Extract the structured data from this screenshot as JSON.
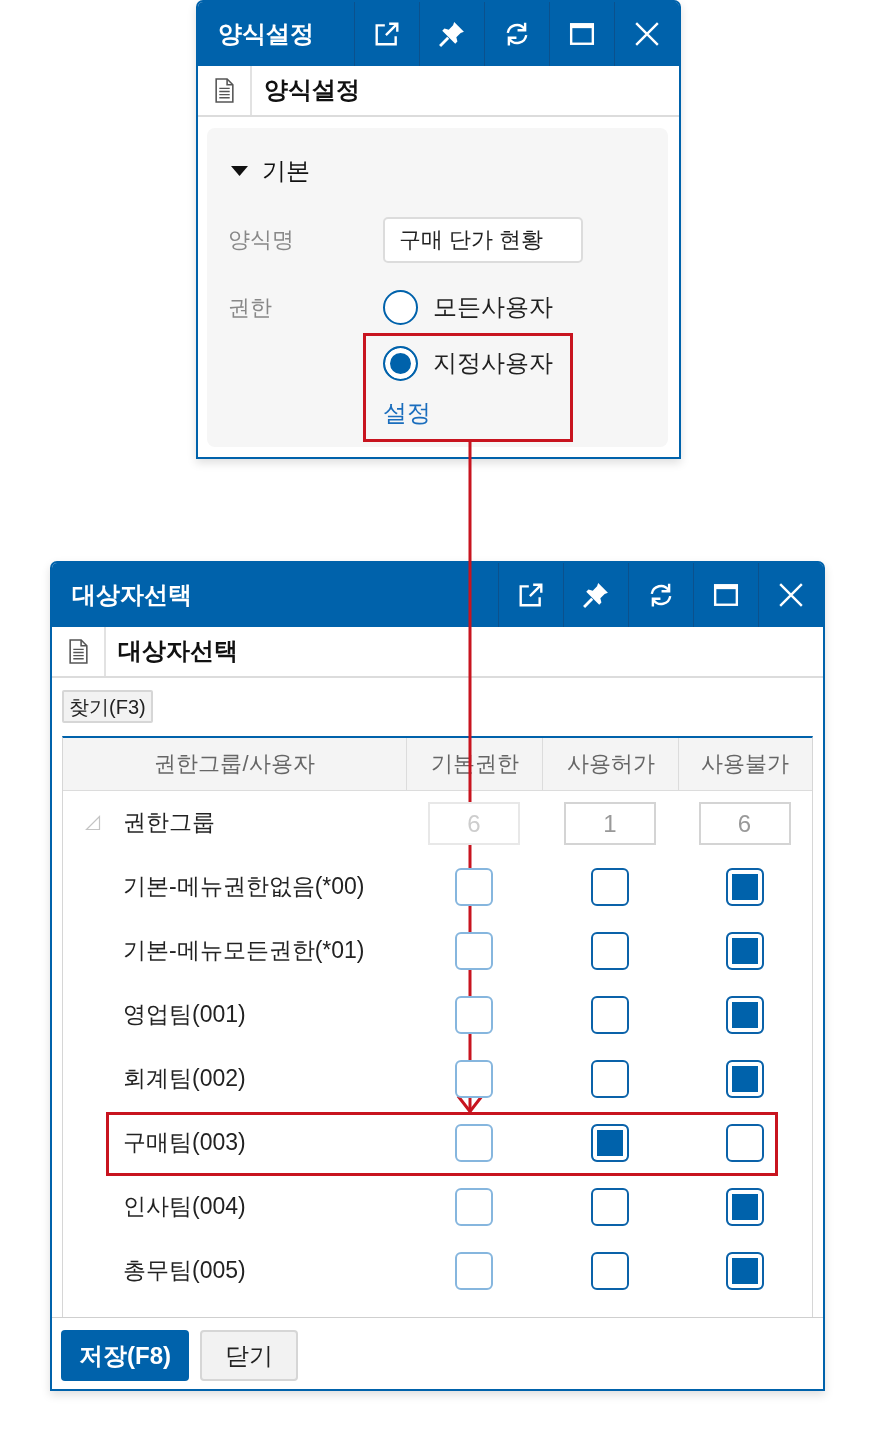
{
  "form_window": {
    "title": "양식설정",
    "header": "양식설정",
    "section": {
      "title": "기본",
      "expanded": true
    },
    "fields": [
      {
        "kind": "text",
        "label": "양식명",
        "value": "구매 단가 현황"
      },
      {
        "kind": "radio",
        "label": "권한",
        "options": [
          {
            "label": "모든사용자",
            "selected": false,
            "highlighted": false
          },
          {
            "label": "지정사용자",
            "selected": true,
            "highlighted": true,
            "link": "설정"
          }
        ]
      }
    ]
  },
  "picker_window": {
    "title": "대상자선택",
    "header": "대상자선택",
    "search_button": "찾기(F3)",
    "table": {
      "columns": [
        "권한그룹/사용자",
        "기본권한",
        "사용허가",
        "사용불가"
      ],
      "rows": [
        {
          "label": "권한그룹",
          "expanded": true,
          "counts": [
            {
              "text": "6",
              "disabled": true
            },
            {
              "text": "1",
              "disabled": false
            },
            {
              "text": "6",
              "disabled": false
            }
          ],
          "children": [
            {
              "label": "기본-메뉴권한없음(*00)",
              "highlighted": false,
              "checks": [
                {
                  "checked": false,
                  "disabled": true
                },
                {
                  "checked": false,
                  "disabled": false
                },
                {
                  "checked": true,
                  "disabled": false
                }
              ]
            },
            {
              "label": "기본-메뉴모든권한(*01)",
              "highlighted": false,
              "checks": [
                {
                  "checked": false,
                  "disabled": true
                },
                {
                  "checked": false,
                  "disabled": false
                },
                {
                  "checked": true,
                  "disabled": false
                }
              ]
            },
            {
              "label": "영업팀(001)",
              "highlighted": false,
              "checks": [
                {
                  "checked": false,
                  "disabled": true
                },
                {
                  "checked": false,
                  "disabled": false
                },
                {
                  "checked": true,
                  "disabled": false
                }
              ]
            },
            {
              "label": "회계팀(002)",
              "highlighted": false,
              "checks": [
                {
                  "checked": false,
                  "disabled": true
                },
                {
                  "checked": false,
                  "disabled": false
                },
                {
                  "checked": true,
                  "disabled": false
                }
              ]
            },
            {
              "label": "구매팀(003)",
              "highlighted": true,
              "checks": [
                {
                  "checked": false,
                  "disabled": true
                },
                {
                  "checked": true,
                  "disabled": false
                },
                {
                  "checked": false,
                  "disabled": false
                }
              ]
            },
            {
              "label": "인사팀(004)",
              "highlighted": false,
              "checks": [
                {
                  "checked": false,
                  "disabled": true
                },
                {
                  "checked": false,
                  "disabled": false
                },
                {
                  "checked": true,
                  "disabled": false
                }
              ]
            },
            {
              "label": "총무팀(005)",
              "highlighted": false,
              "checks": [
                {
                  "checked": false,
                  "disabled": true
                },
                {
                  "checked": false,
                  "disabled": false
                },
                {
                  "checked": true,
                  "disabled": false
                }
              ]
            }
          ]
        }
      ]
    },
    "buttons": [
      {
        "label": "저장(F8)",
        "kind": "save"
      },
      {
        "label": "닫기",
        "kind": "close"
      }
    ]
  }
}
